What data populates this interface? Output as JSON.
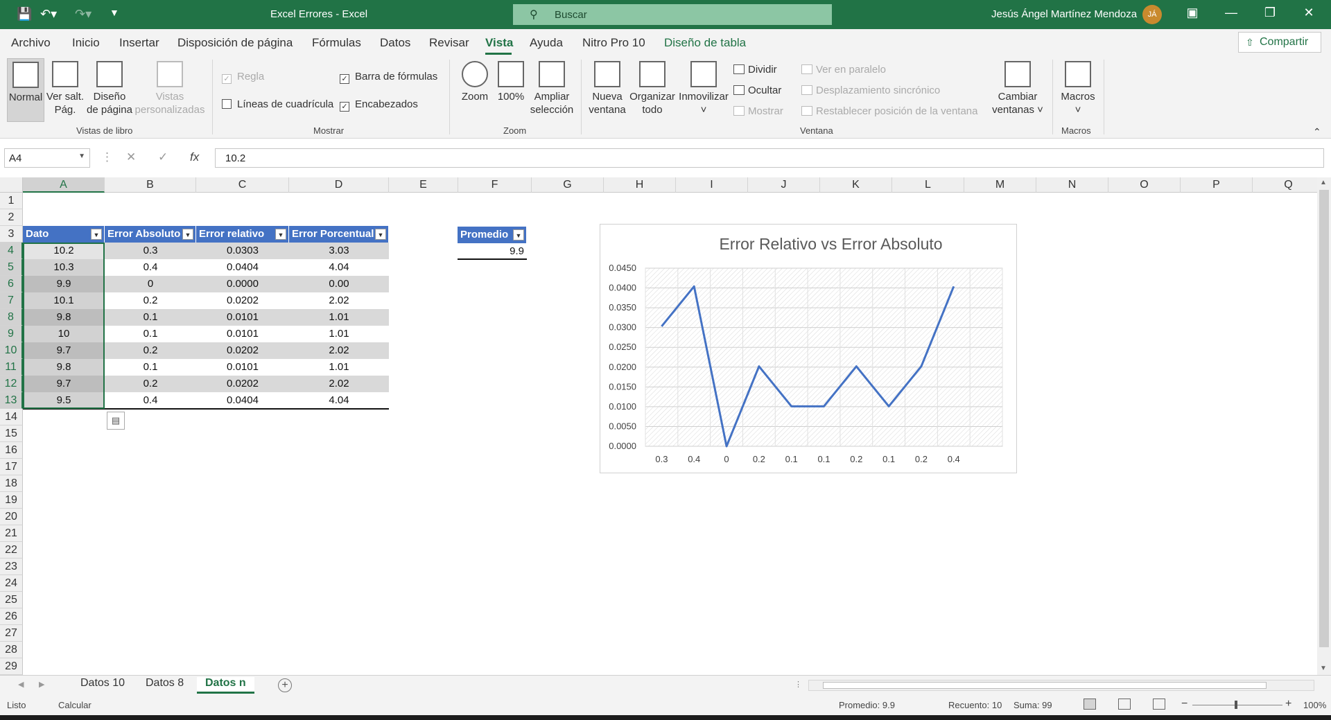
{
  "titlebar": {
    "doc_title": "Excel Errores  -  Excel",
    "search_placeholder": "Buscar",
    "user": "Jesús Ángel Martínez Mendoza",
    "initials": "JÁ",
    "bg": "#217346"
  },
  "tabs": [
    "Archivo",
    "Inicio",
    "Insertar",
    "Disposición de página",
    "Fórmulas",
    "Datos",
    "Revisar",
    "Vista",
    "Ayuda",
    "Nitro Pro 10",
    "Diseño de tabla"
  ],
  "active_tab": "Vista",
  "share_label": "Compartir",
  "ribbon": {
    "vistas": {
      "normal": "Normal",
      "salt": [
        "Ver salt.",
        "Pág."
      ],
      "diseno": [
        "Diseño",
        "de página"
      ],
      "personalizadas": [
        "Vistas",
        "personalizadas"
      ],
      "group": "Vistas de libro"
    },
    "mostrar": {
      "regla": "Regla",
      "barra": "Barra de fórmulas",
      "lineas": "Líneas de cuadrícula",
      "encabezados": "Encabezados",
      "group": "Mostrar"
    },
    "zoom": {
      "zoom": "Zoom",
      "cien": "100%",
      "ampliar": [
        "Ampliar",
        "selección"
      ],
      "group": "Zoom"
    },
    "ventana": {
      "nueva": [
        "Nueva",
        "ventana"
      ],
      "organizar": [
        "Organizar",
        "todo"
      ],
      "inmovilizar": "Inmovilizar",
      "dividir": "Dividir",
      "ocultar": "Ocultar",
      "mostrar": "Mostrar",
      "paralelo": "Ver en paralelo",
      "sincronico": "Desplazamiento sincrónico",
      "restablecer": "Restablecer posición de la ventana",
      "cambiar": [
        "Cambiar",
        "ventanas"
      ],
      "group": "Ventana"
    },
    "macros": {
      "macros": "Macros",
      "group": "Macros"
    }
  },
  "formula_bar": {
    "name_box": "A4",
    "formula": "10.2",
    "fx": "fx"
  },
  "columns": [
    "A",
    "B",
    "C",
    "D",
    "E",
    "F",
    "G",
    "H",
    "I",
    "J",
    "K",
    "L",
    "M",
    "N",
    "O",
    "P",
    "Q"
  ],
  "rows": [
    "1",
    "2",
    "3",
    "4",
    "5",
    "6",
    "7",
    "8",
    "9",
    "10",
    "11",
    "12",
    "13",
    "14",
    "15",
    "16",
    "17",
    "18",
    "19",
    "20",
    "21",
    "22",
    "23",
    "24",
    "25",
    "26",
    "27",
    "28",
    "29"
  ],
  "table": {
    "headers": [
      "Dato",
      "Error Absoluto",
      "Error relativo",
      "Error Porcentual"
    ],
    "rows": [
      [
        "10.2",
        "0.3",
        "0.0303",
        "3.03"
      ],
      [
        "10.3",
        "0.4",
        "0.0404",
        "4.04"
      ],
      [
        "9.9",
        "0",
        "0.0000",
        "0.00"
      ],
      [
        "10.1",
        "0.2",
        "0.0202",
        "2.02"
      ],
      [
        "9.8",
        "0.1",
        "0.0101",
        "1.01"
      ],
      [
        "10",
        "0.1",
        "0.0101",
        "1.01"
      ],
      [
        "9.7",
        "0.2",
        "0.0202",
        "2.02"
      ],
      [
        "9.8",
        "0.1",
        "0.0101",
        "1.01"
      ],
      [
        "9.7",
        "0.2",
        "0.0202",
        "2.02"
      ],
      [
        "9.5",
        "0.4",
        "0.0404",
        "4.04"
      ]
    ],
    "header_color": "#4472c4"
  },
  "avg_table": {
    "header": "Promedio",
    "value": "9.9"
  },
  "chart_data": {
    "type": "line",
    "title": "Error Relativo vs Error Absoluto",
    "categories": [
      "0.3",
      "0.4",
      "0",
      "0.2",
      "0.1",
      "0.1",
      "0.2",
      "0.1",
      "0.2",
      "0.4"
    ],
    "values": [
      0.0303,
      0.0404,
      0.0,
      0.0202,
      0.0101,
      0.0101,
      0.0202,
      0.0101,
      0.0202,
      0.0404
    ],
    "y_ticks": [
      "0.0000",
      "0.0050",
      "0.0100",
      "0.0150",
      "0.0200",
      "0.0250",
      "0.0300",
      "0.0350",
      "0.0400",
      "0.0450"
    ],
    "ylim": [
      0,
      0.045
    ],
    "grid": true,
    "line_color": "#4472c4"
  },
  "sheets": [
    "Datos 10",
    "Datos 8",
    "Datos n"
  ],
  "active_sheet": "Datos n",
  "status": {
    "ready": "Listo",
    "calc": "Calcular",
    "avg": "Promedio: 9.9",
    "count": "Recuento: 10",
    "sum": "Suma: 99",
    "zoom": "100%"
  }
}
